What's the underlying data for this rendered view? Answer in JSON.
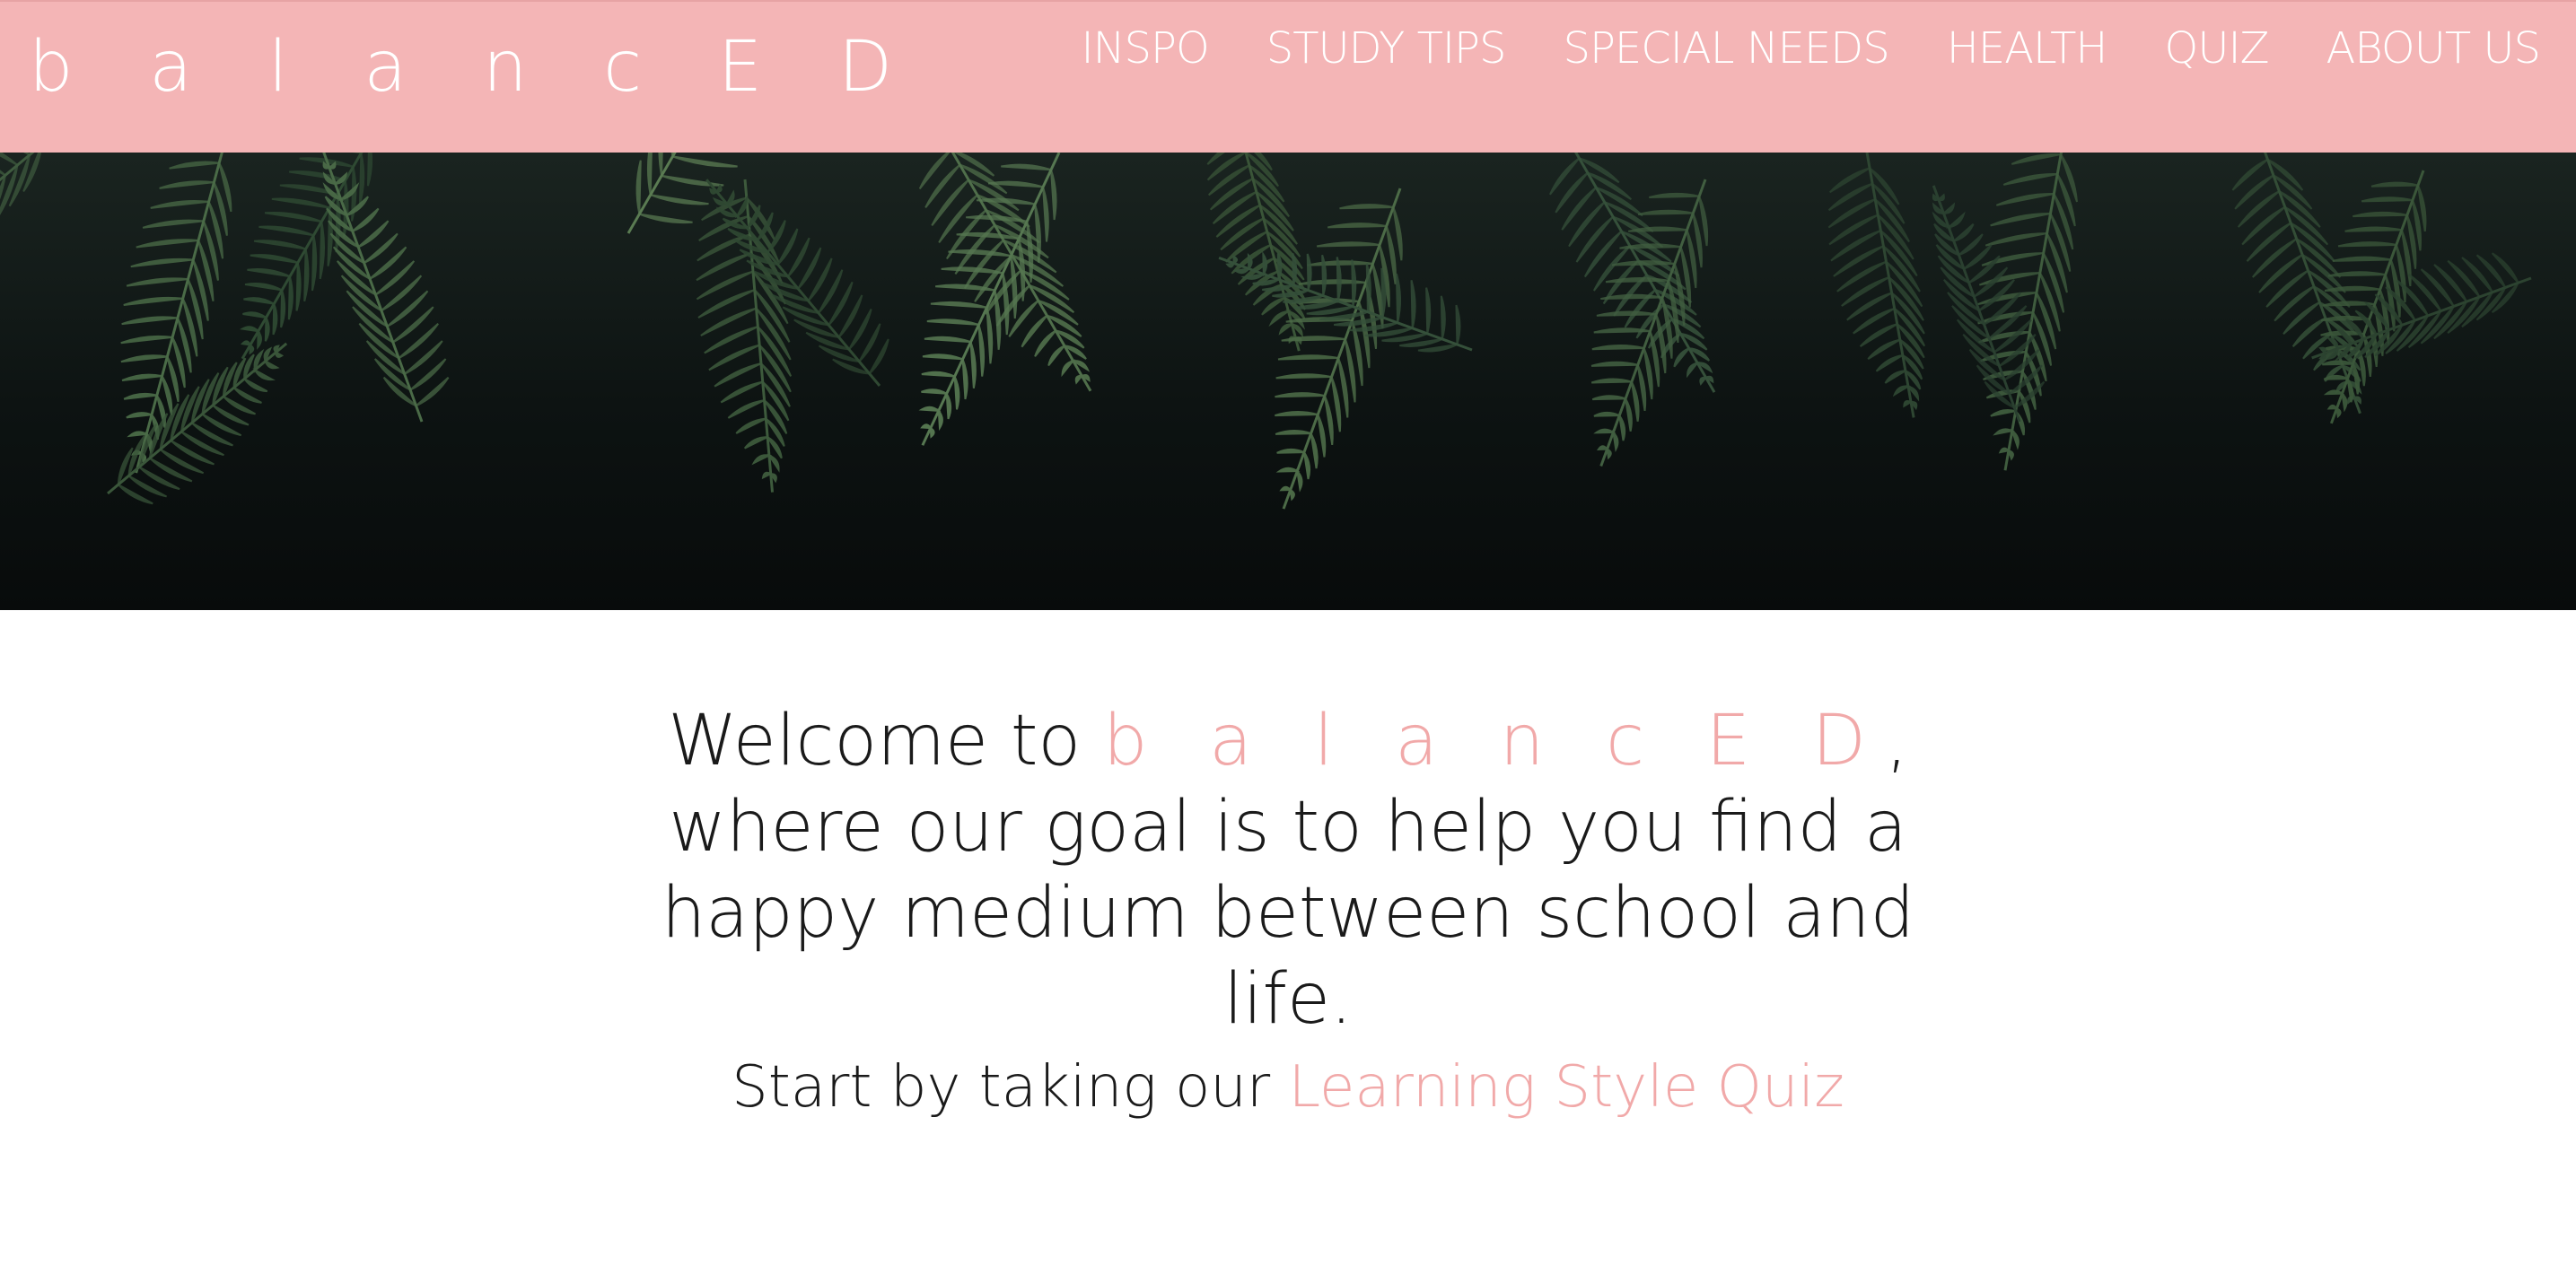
{
  "header": {
    "brand": "b a l a n c E D",
    "nav": [
      {
        "label": "INSPO"
      },
      {
        "label": "STUDY TIPS"
      },
      {
        "label": "SPECIAL NEEDS"
      },
      {
        "label": "HEALTH"
      },
      {
        "label": "QUIZ"
      },
      {
        "label": "ABOUT US"
      }
    ]
  },
  "hero": {
    "image": "palm-leaves-photo"
  },
  "main": {
    "welcome_prefix": "Welcome to ",
    "welcome_brand": "b a l a n c E D",
    "welcome_suffix": ", where our goal is to help you find a happy medium between school and life.",
    "cta_prefix": "Start by taking our ",
    "cta_link": "Learning Style Quiz"
  },
  "colors": {
    "header_bg": "#f4b5b6",
    "accent_pink": "#f1a9a9",
    "text_dark": "#1a1a1a",
    "hero_dark": "#0a0e0e"
  }
}
